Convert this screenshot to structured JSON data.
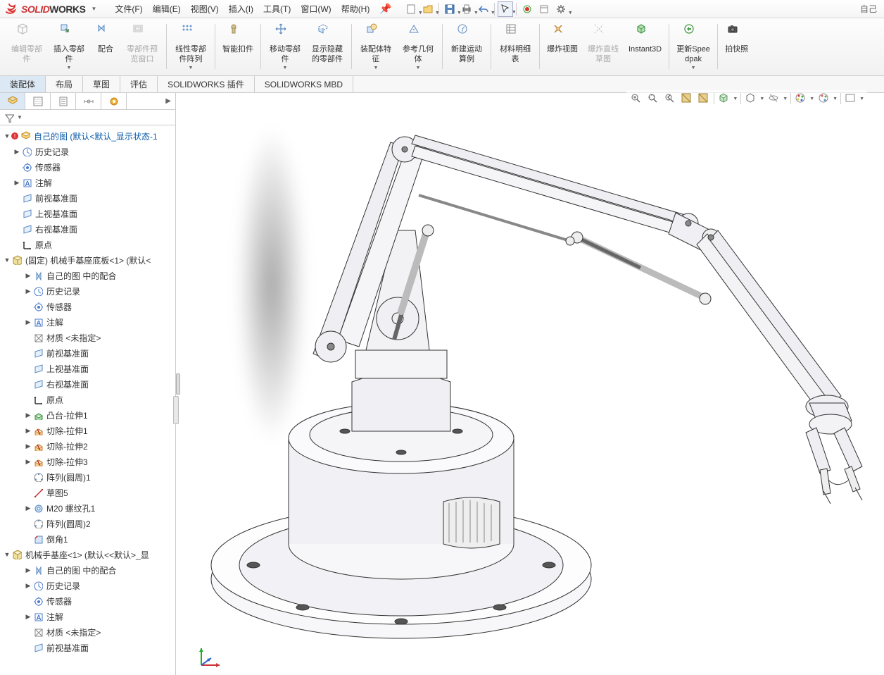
{
  "app": {
    "brand_solid": "SOLID",
    "brand_works": "WORKS",
    "title_right": "自己"
  },
  "menu": {
    "items": [
      {
        "label": "文件(F)"
      },
      {
        "label": "编辑(E)"
      },
      {
        "label": "视图(V)"
      },
      {
        "label": "插入(I)"
      },
      {
        "label": "工具(T)"
      },
      {
        "label": "窗口(W)"
      },
      {
        "label": "帮助(H)"
      }
    ]
  },
  "ribbon": [
    {
      "label": "编辑零部件",
      "icon": "cube",
      "disabled": true
    },
    {
      "label": "插入零部件",
      "icon": "insert",
      "dd": true
    },
    {
      "label": "配合",
      "icon": "mate"
    },
    {
      "label": "零部件预览窗口",
      "icon": "preview",
      "disabled": true
    },
    {
      "sep": true
    },
    {
      "label": "线性零部件阵列",
      "icon": "pattern",
      "dd": true
    },
    {
      "sep": true
    },
    {
      "label": "智能扣件",
      "icon": "smartfast"
    },
    {
      "sep": true
    },
    {
      "label": "移动零部件",
      "icon": "move",
      "dd": true
    },
    {
      "label": "显示隐藏的零部件",
      "icon": "showhide"
    },
    {
      "sep": true
    },
    {
      "label": "装配体特征",
      "icon": "feature",
      "dd": true
    },
    {
      "label": "参考几何体",
      "icon": "refgeo",
      "dd": true
    },
    {
      "sep": true
    },
    {
      "label": "新建运动算例",
      "icon": "motion"
    },
    {
      "sep": true
    },
    {
      "label": "材料明细表",
      "icon": "bom"
    },
    {
      "sep": true
    },
    {
      "label": "爆炸视图",
      "icon": "explode"
    },
    {
      "label": "爆炸直线草图",
      "icon": "explodeline",
      "disabled": true
    },
    {
      "label": "Instant3D",
      "icon": "instant3d"
    },
    {
      "sep": true
    },
    {
      "label": "更新Speedpak",
      "icon": "speedpak",
      "dd": true
    },
    {
      "sep": true
    },
    {
      "label": "拍快照",
      "icon": "snapshot"
    }
  ],
  "tabs2": [
    {
      "label": "装配体",
      "active": true
    },
    {
      "label": "布局"
    },
    {
      "label": "草图"
    },
    {
      "label": "评估"
    },
    {
      "label": "SOLIDWORKS 插件"
    },
    {
      "label": "SOLIDWORKS MBD"
    }
  ],
  "tree": {
    "root": "自己的图  (默认<默认_显示状态-1",
    "top": [
      {
        "icon": "history",
        "label": "历史记录",
        "tw": "▶"
      },
      {
        "icon": "sensor",
        "label": "传感器"
      },
      {
        "icon": "annot",
        "label": "注解",
        "tw": "▶"
      },
      {
        "icon": "plane",
        "label": "前视基准面"
      },
      {
        "icon": "plane",
        "label": "上视基准面"
      },
      {
        "icon": "plane",
        "label": "右视基准面"
      },
      {
        "icon": "origin",
        "label": "原点"
      }
    ],
    "part1": {
      "label": "(固定) 机械手基座底板<1> (默认<",
      "children": [
        {
          "icon": "mates",
          "label": "自己的图 中的配合",
          "tw": "▶"
        },
        {
          "icon": "history",
          "label": "历史记录",
          "tw": "▶"
        },
        {
          "icon": "sensor",
          "label": "传感器"
        },
        {
          "icon": "annot",
          "label": "注解",
          "tw": "▶"
        },
        {
          "icon": "material",
          "label": "材质 <未指定>"
        },
        {
          "icon": "plane",
          "label": "前视基准面"
        },
        {
          "icon": "plane",
          "label": "上视基准面"
        },
        {
          "icon": "plane",
          "label": "右视基准面"
        },
        {
          "icon": "origin",
          "label": "原点"
        },
        {
          "icon": "extrude",
          "label": "凸台-拉伸1",
          "tw": "▶"
        },
        {
          "icon": "cut",
          "label": "切除-拉伸1",
          "tw": "▶"
        },
        {
          "icon": "cut",
          "label": "切除-拉伸2",
          "tw": "▶"
        },
        {
          "icon": "cut",
          "label": "切除-拉伸3",
          "tw": "▶"
        },
        {
          "icon": "cpattern",
          "label": "阵列(圆周)1"
        },
        {
          "icon": "sketch",
          "label": "草图5"
        },
        {
          "icon": "hole",
          "label": "M20 螺纹孔1",
          "tw": "▶"
        },
        {
          "icon": "cpattern",
          "label": "阵列(圆周)2"
        },
        {
          "icon": "chamfer",
          "label": "倒角1"
        }
      ]
    },
    "part2": {
      "label": "机械手基座<1> (默认<<默认>_显",
      "children": [
        {
          "icon": "mates",
          "label": "自己的图 中的配合",
          "tw": "▶"
        },
        {
          "icon": "history",
          "label": "历史记录",
          "tw": "▶"
        },
        {
          "icon": "sensor",
          "label": "传感器"
        },
        {
          "icon": "annot",
          "label": "注解",
          "tw": "▶"
        },
        {
          "icon": "material",
          "label": "材质 <未指定>"
        },
        {
          "icon": "plane",
          "label": "前视基准面"
        }
      ]
    }
  }
}
